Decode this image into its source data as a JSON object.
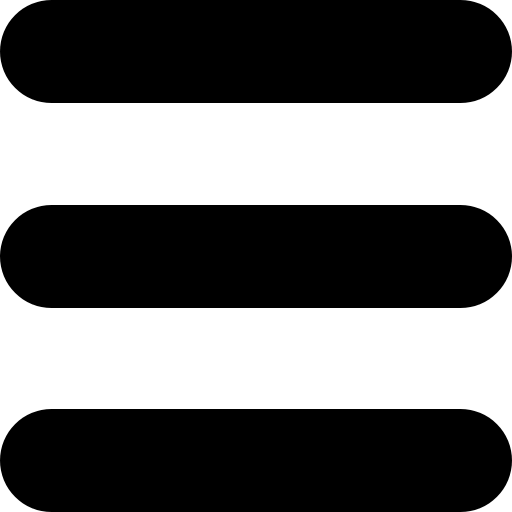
{
  "icon": {
    "name": "hamburger-menu-icon",
    "color": "#000000",
    "background": "#ffffff",
    "bar_count": 3
  }
}
